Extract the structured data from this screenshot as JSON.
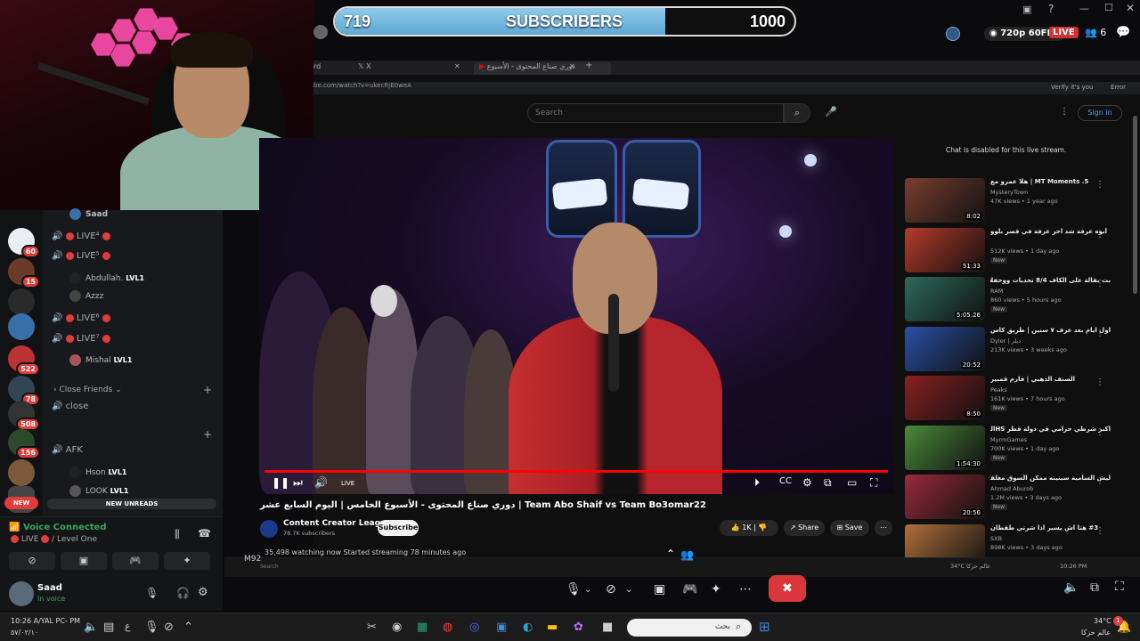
{
  "subscriber_goal": {
    "current": "719",
    "label": "SUBSCRIBERS",
    "target": "1000",
    "fraction": 0.719
  },
  "stream_status": {
    "quality": "720p 60FPS",
    "live": "LIVE",
    "viewers": "6"
  },
  "discord": {
    "server_badges": [
      "60",
      "15",
      "522",
      "78",
      "508",
      "156"
    ],
    "new_badge": "NEW",
    "new_unreads": "NEW UNREADS",
    "top_user": "Saad",
    "channels": [
      {
        "label": "LIVE⁴"
      },
      {
        "label": "LIVE⁵"
      },
      {
        "label": "LIVE⁶"
      },
      {
        "label": "LIVE⁷"
      }
    ],
    "members": [
      {
        "name": "Abdullah.",
        "level": "LVL1"
      },
      {
        "name": "Azzz",
        "level": ""
      },
      {
        "name": "Mishal",
        "level": "LVL1"
      }
    ],
    "category_close_friends": "Close Friends",
    "channel_close": "close",
    "channel_afk": "AFK",
    "afk_members": [
      {
        "name": "Hson",
        "level": "LVL1"
      },
      {
        "name": "LOOK",
        "level": "LVL1"
      }
    ],
    "voice": {
      "title": "Voice Connected",
      "live": "LIVE",
      "channel": "/ Level One"
    },
    "user": {
      "name": "Saad",
      "status": "In voice"
    }
  },
  "browser": {
    "tabs": [
      "X",
      "دوري صناع المحتوى - الأسبوع"
    ],
    "address": "be.com/watch?v=ukecRjE0weA",
    "verify": "Verify it's you",
    "error": "Error"
  },
  "youtube": {
    "search_placeholder": "Search",
    "sign_in": "Sign in",
    "chat_disabled": "Chat is disabled for this live stream.",
    "live_label": "LIVE",
    "video_title": "دوري صناع المحتوى - الأسبوع الخامس | اليوم السابع عشر | Team Abo Shaif vs Team Bo3omar22",
    "channel_name": "Content Creator League",
    "channel_subs": "78.7K subscribers",
    "subscribe": "Subscribe",
    "likes": "1K",
    "share": "Share",
    "save": "Save",
    "watching": "35,498 watching now  Started streaming 78 minutes ago",
    "recommended": [
      {
        "title": "MT Moments .5 | هلا عمرو مع",
        "channel": "MysteryTown",
        "views": "47K views • 1 year ago",
        "duration": "8:02",
        "badge": "",
        "color": "#7a3e2f"
      },
      {
        "title": "أبوه عرفة شد آخر عرفة في قصر بلوو",
        "channel": "",
        "views": "512K views • 1 day ago",
        "duration": "51:33",
        "badge": "New",
        "color": "#b83a2a"
      },
      {
        "title": "بث بقالة على الكاف 8/4 تحديات ووحفلات",
        "channel": "RAM",
        "views": "860 views • 5 hours ago",
        "duration": "5:05:26",
        "badge": "New",
        "color": "#2d6a5a"
      },
      {
        "title": "اول ايام بعد عرف ٧ سنين | طريق كاس TU",
        "channel": "Dyler | ديلر",
        "views": "213K views • 3 weeks ago",
        "duration": "20:52",
        "badge": "",
        "color": "#2a4ea8"
      },
      {
        "title": "الصنف الذهبي | فارم قمبير",
        "channel": "Peaks",
        "views": "161K views • 7 hours ago",
        "duration": "8:50",
        "badge": "New",
        "color": "#8a2020"
      },
      {
        "title": "اكبر شرطي حرامي في دولة قطر HSالحلقه",
        "channel": "MyrmGames",
        "views": "700K views • 1 day ago",
        "duration": "1:54:30",
        "badge": "New",
        "color": "#4a8a3a"
      },
      {
        "title": "ليش السامية سينينه ممكن السوق مغلقين؟",
        "channel": "Ahmad Aburob",
        "views": "1.2M views • 3 days ago",
        "duration": "20:56",
        "badge": "New",
        "color": "#9a2a3a"
      },
      {
        "title": "#3 هنا اش يسير اذا شرتي طقطان",
        "channel": "SXB",
        "views": "898K views • 3 days ago",
        "duration": "",
        "badge": "",
        "color": "#b0703a"
      }
    ]
  },
  "inner_taskbar": {
    "label": "M92",
    "search": "Search",
    "weather": "34°C عالم حزكا",
    "time": "10:26 PM"
  },
  "taskbar": {
    "time": "10:26 A/YAL PC- PM",
    "date": "٥٧/٠٢/١٠",
    "lang": "ع",
    "search_placeholder": "بحث",
    "weather_temp": "34°C",
    "weather_loc": "عالم حزكا",
    "notif_count": "1"
  }
}
